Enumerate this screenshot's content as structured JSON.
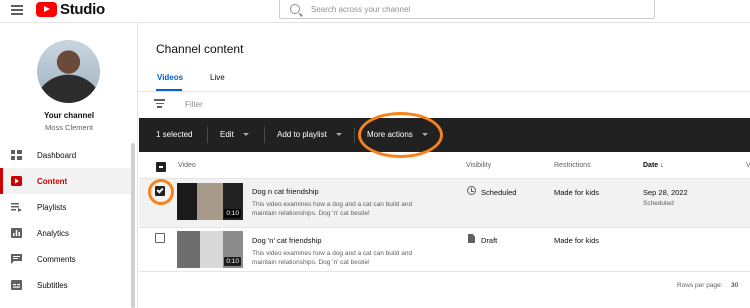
{
  "app": {
    "name": "Studio",
    "search_placeholder": "Search across your channel"
  },
  "sidebar": {
    "channel_label": "Your channel",
    "channel_name": "Moss Clement",
    "items": [
      {
        "label": "Dashboard",
        "icon": "dashboard-icon"
      },
      {
        "label": "Content",
        "icon": "content-icon",
        "active": true
      },
      {
        "label": "Playlists",
        "icon": "playlists-icon"
      },
      {
        "label": "Analytics",
        "icon": "analytics-icon"
      },
      {
        "label": "Comments",
        "icon": "comments-icon"
      },
      {
        "label": "Subtitles",
        "icon": "subtitles-icon"
      }
    ]
  },
  "main": {
    "title": "Channel content",
    "tabs": [
      {
        "label": "Videos",
        "active": true
      },
      {
        "label": "Live"
      }
    ],
    "filter_label": "Filter",
    "action_bar": {
      "selected": "1 selected",
      "edit": "Edit",
      "add_to_playlist": "Add to playlist",
      "more_actions": "More actions"
    },
    "columns": {
      "video": "Video",
      "visibility": "Visibility",
      "restrictions": "Restrictions",
      "date": "Date",
      "overflow": "V"
    },
    "rows": [
      {
        "title": "Dog n cat friendship",
        "description": "This video examines how a dog and a cat can build and maintain relationships. Dog 'n' cat bestie!",
        "duration": "0:10",
        "visibility": "Scheduled",
        "restrictions": "Made for kids",
        "date": "Sep 28, 2022",
        "date_status": "Scheduled",
        "selected": true
      },
      {
        "title": "Dog 'n' cat friendship",
        "description": "This video examines how a dog and a cat can build and maintain relationships. Dog 'n' cat bestie!",
        "duration": "0:10",
        "visibility": "Draft",
        "restrictions": "Made for kids",
        "date": "",
        "date_status": "",
        "selected": false
      }
    ],
    "footer": {
      "rows_per_page_label": "Rows per page:",
      "rows_per_page_value": "30"
    }
  },
  "colors": {
    "accent": "#065fd4",
    "brand": "#ff0000",
    "highlight": "#f7821b",
    "active_nav": "#cc0000"
  }
}
